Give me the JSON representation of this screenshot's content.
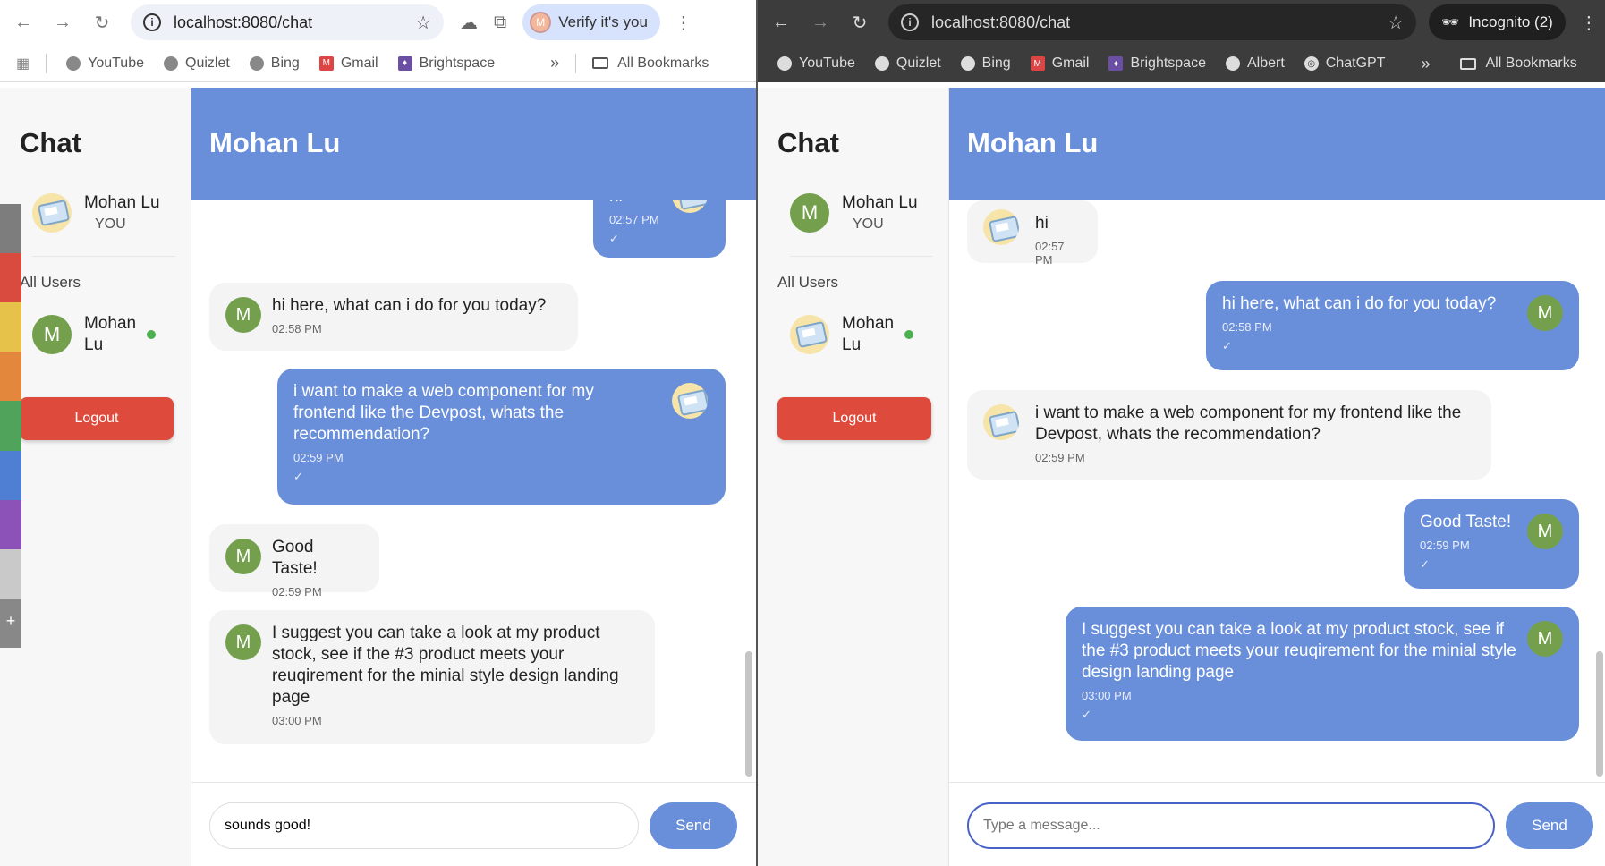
{
  "left": {
    "url": "localhost:8080/chat",
    "verify_label": "Verify it's you",
    "verify_avatar": "M",
    "bookmarks": [
      "YouTube",
      "Quizlet",
      "Bing",
      "Gmail",
      "Brightspace"
    ],
    "all_bookmarks": "All Bookmarks",
    "sidebar": {
      "title": "Chat",
      "me_name": "Mohan Lu",
      "me_you": "YOU",
      "all_users": "All Users",
      "user_name": "Mohan Lu",
      "logout": "Logout"
    },
    "header_title": "Mohan Lu",
    "messages": [
      {
        "text": "hi",
        "time": "02:57 PM",
        "tick": "✓"
      },
      {
        "text": "hi here, what can i do for you today?",
        "time": "02:58 PM",
        "avatar": "M"
      },
      {
        "text": "i want to make a web component for my frontend like the Devpost, whats the recommendation?",
        "time": "02:59 PM",
        "tick": "✓"
      },
      {
        "text": "Good Taste!",
        "time": "02:59 PM",
        "avatar": "M"
      },
      {
        "text": "I suggest you can take a look at my product stock, see if the #3 product meets your reuqirement for the minial style design landing page",
        "time": "03:00 PM",
        "avatar": "M"
      }
    ],
    "input_value": "sounds good!",
    "send": "Send"
  },
  "right": {
    "url": "localhost:8080/chat",
    "incognito": "Incognito (2)",
    "bookmarks": [
      "YouTube",
      "Quizlet",
      "Bing",
      "Gmail",
      "Brightspace",
      "Albert",
      "ChatGPT"
    ],
    "all_bookmarks": "All Bookmarks",
    "sidebar": {
      "title": "Chat",
      "me_avatar": "M",
      "me_name": "Mohan Lu",
      "me_you": "YOU",
      "all_users": "All Users",
      "user_name": "Mohan Lu",
      "logout": "Logout"
    },
    "header_title": "Mohan Lu",
    "messages": [
      {
        "text": "hi",
        "time": "02:57 PM"
      },
      {
        "text": "hi here, what can i do for you today?",
        "time": "02:58 PM",
        "avatar": "M",
        "tick": "✓"
      },
      {
        "text": "i want to make a web component for my frontend like the Devpost, whats the recommendation?",
        "time": "02:59 PM"
      },
      {
        "text": "Good Taste!",
        "time": "02:59 PM",
        "avatar": "M",
        "tick": "✓"
      },
      {
        "text": "I suggest you can take a look at my product stock, see if the #3 product meets your reuqirement for the minial style design landing page",
        "time": "03:00 PM",
        "avatar": "M",
        "tick": "✓"
      }
    ],
    "input_placeholder": "Type a message...",
    "send": "Send"
  },
  "colors": {
    "header": "#6a8fda",
    "logout": "#de4a3c",
    "online": "#4caf50",
    "avatar": "#74a04d"
  }
}
